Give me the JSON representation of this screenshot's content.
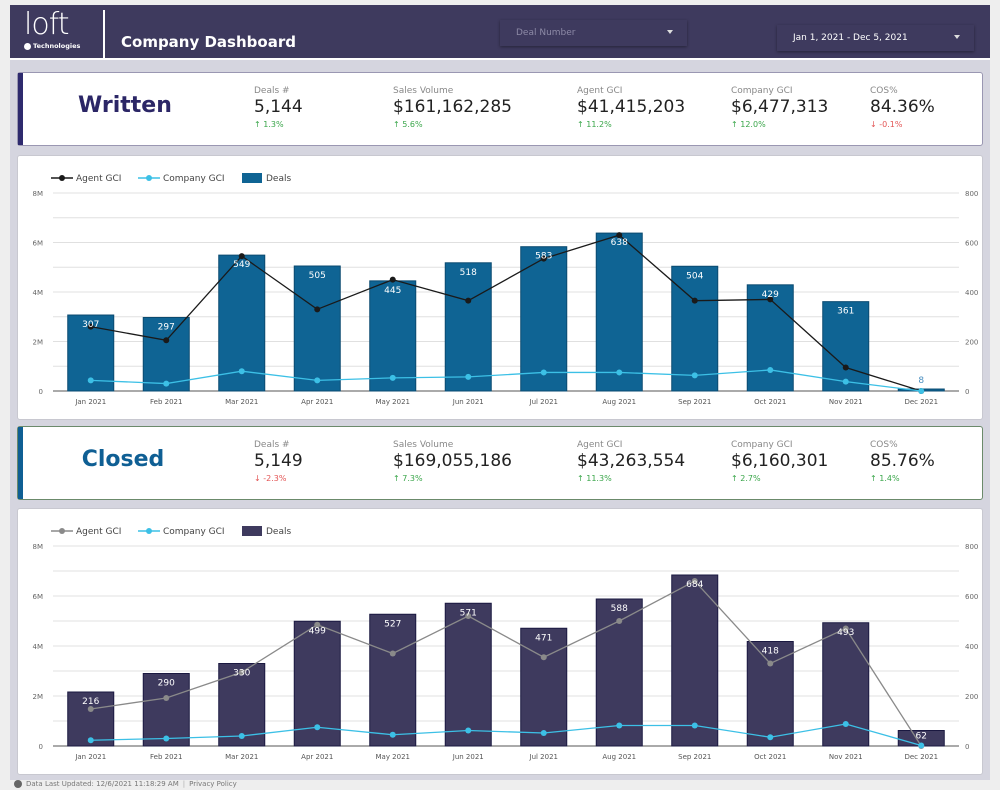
{
  "header": {
    "logo_word": "loft",
    "logo_sub": "Technologies",
    "title": "Company Dashboard",
    "deal_filter_placeholder": "Deal Number",
    "date_range": "Jan 1, 2021 - Dec 5, 2021"
  },
  "written": {
    "label": "Written",
    "metrics": [
      {
        "name": "Deals #",
        "value": "5,144",
        "delta": "1.3%",
        "dir": "up"
      },
      {
        "name": "Sales Volume",
        "value": "$161,162,285",
        "delta": "5.6%",
        "dir": "up"
      },
      {
        "name": "Agent GCI",
        "value": "$41,415,203",
        "delta": "11.2%",
        "dir": "up"
      },
      {
        "name": "Company GCI",
        "value": "$6,477,313",
        "delta": "12.0%",
        "dir": "up"
      },
      {
        "name": "COS%",
        "value": "84.36%",
        "delta": "-0.1%",
        "dir": "down"
      }
    ]
  },
  "closed": {
    "label": "Closed",
    "metrics": [
      {
        "name": "Deals #",
        "value": "5,149",
        "delta": "-2.3%",
        "dir": "down"
      },
      {
        "name": "Sales Volume",
        "value": "$169,055,186",
        "delta": "7.3%",
        "dir": "up"
      },
      {
        "name": "Agent GCI",
        "value": "$43,263,554",
        "delta": "11.3%",
        "dir": "up"
      },
      {
        "name": "Company GCI",
        "value": "$6,160,301",
        "delta": "2.7%",
        "dir": "up"
      },
      {
        "name": "COS%",
        "value": "85.76%",
        "delta": "1.4%",
        "dir": "up"
      }
    ]
  },
  "chart_data": [
    {
      "type": "bar",
      "title": "Written",
      "categories": [
        "Jan 2021",
        "Feb 2021",
        "Mar 2021",
        "Apr 2021",
        "May 2021",
        "Jun 2021",
        "Jul 2021",
        "Aug 2021",
        "Sep 2021",
        "Oct 2021",
        "Nov 2021",
        "Dec 2021"
      ],
      "left_axis": {
        "ticks": [
          "0",
          "2M",
          "4M",
          "6M",
          "8M"
        ],
        "range": [
          0,
          8000000
        ]
      },
      "right_axis": {
        "ticks": [
          "0",
          "200",
          "400",
          "600",
          "800"
        ],
        "range": [
          0,
          800
        ]
      },
      "grid": true,
      "legend": "top-left",
      "colors": {
        "bars": "#0f6494",
        "agent": "#1a1a1a",
        "company": "#3cc0e6"
      },
      "series": [
        {
          "name": "Agent GCI",
          "kind": "line",
          "axis": "left",
          "values": [
            2600000,
            2050000,
            5450000,
            3300000,
            4500000,
            3650000,
            5350000,
            6300000,
            3650000,
            3700000,
            950000,
            0
          ]
        },
        {
          "name": "Company GCI",
          "kind": "line",
          "axis": "left",
          "values": [
            430000,
            300000,
            800000,
            430000,
            530000,
            570000,
            750000,
            750000,
            630000,
            850000,
            380000,
            0
          ]
        },
        {
          "name": "Deals",
          "kind": "bar",
          "axis": "right",
          "values": [
            307,
            297,
            549,
            505,
            445,
            518,
            583,
            638,
            504,
            429,
            361,
            8
          ]
        }
      ]
    },
    {
      "type": "bar",
      "title": "Closed",
      "categories": [
        "Jan 2021",
        "Feb 2021",
        "Mar 2021",
        "Apr 2021",
        "May 2021",
        "Jun 2021",
        "Jul 2021",
        "Aug 2021",
        "Sep 2021",
        "Oct 2021",
        "Nov 2021",
        "Dec 2021"
      ],
      "left_axis": {
        "ticks": [
          "0",
          "2M",
          "4M",
          "6M",
          "8M"
        ],
        "range": [
          0,
          8000000
        ]
      },
      "right_axis": {
        "ticks": [
          "0",
          "200",
          "400",
          "600",
          "800"
        ],
        "range": [
          0,
          800
        ]
      },
      "grid": true,
      "legend": "top-left",
      "colors": {
        "bars": "#3e3a5e",
        "agent": "#8a8a8a",
        "company": "#3cc0e6"
      },
      "series": [
        {
          "name": "Agent GCI",
          "kind": "line",
          "axis": "left",
          "values": [
            1480000,
            1920000,
            2950000,
            4850000,
            3700000,
            5200000,
            3550000,
            5000000,
            6600000,
            3300000,
            4700000,
            0
          ]
        },
        {
          "name": "Company GCI",
          "kind": "line",
          "axis": "left",
          "values": [
            230000,
            300000,
            400000,
            750000,
            450000,
            620000,
            520000,
            820000,
            820000,
            350000,
            880000,
            20000
          ]
        },
        {
          "name": "Deals",
          "kind": "bar",
          "axis": "right",
          "values": [
            216,
            290,
            330,
            499,
            527,
            571,
            471,
            588,
            684,
            418,
            493,
            62
          ]
        }
      ]
    }
  ],
  "footer": {
    "updated": "Data Last Updated: 12/6/2021 11:18:29 AM",
    "privacy": "Privacy Policy"
  }
}
